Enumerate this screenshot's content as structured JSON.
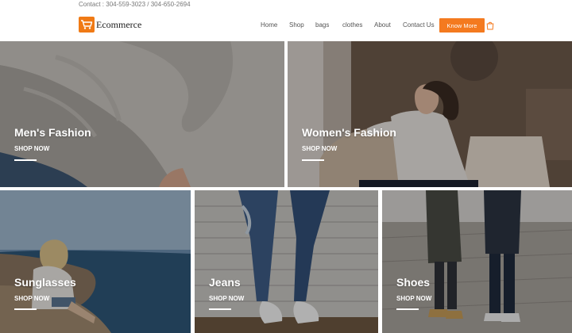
{
  "topbar": {
    "contact": "Contact : 304-559-3023 / 304-650-2694"
  },
  "brand": {
    "name": "Ecommerce",
    "accent": "#f47a1f"
  },
  "nav": {
    "items": [
      "Home",
      "Shop",
      "bags",
      "clothes",
      "About",
      "Contact Us"
    ],
    "cta_label": "Know More",
    "cart_icon": "shopping-bag-icon"
  },
  "categories": [
    {
      "title": "Men's Fashion",
      "link": "SHOP NOW"
    },
    {
      "title": "Women's Fashion",
      "link": "SHOP NOW"
    },
    {
      "title": "Sunglasses",
      "link": "SHOP NOW"
    },
    {
      "title": "Jeans",
      "link": "SHOP NOW"
    },
    {
      "title": "Shoes",
      "link": "SHOP NOW"
    }
  ]
}
